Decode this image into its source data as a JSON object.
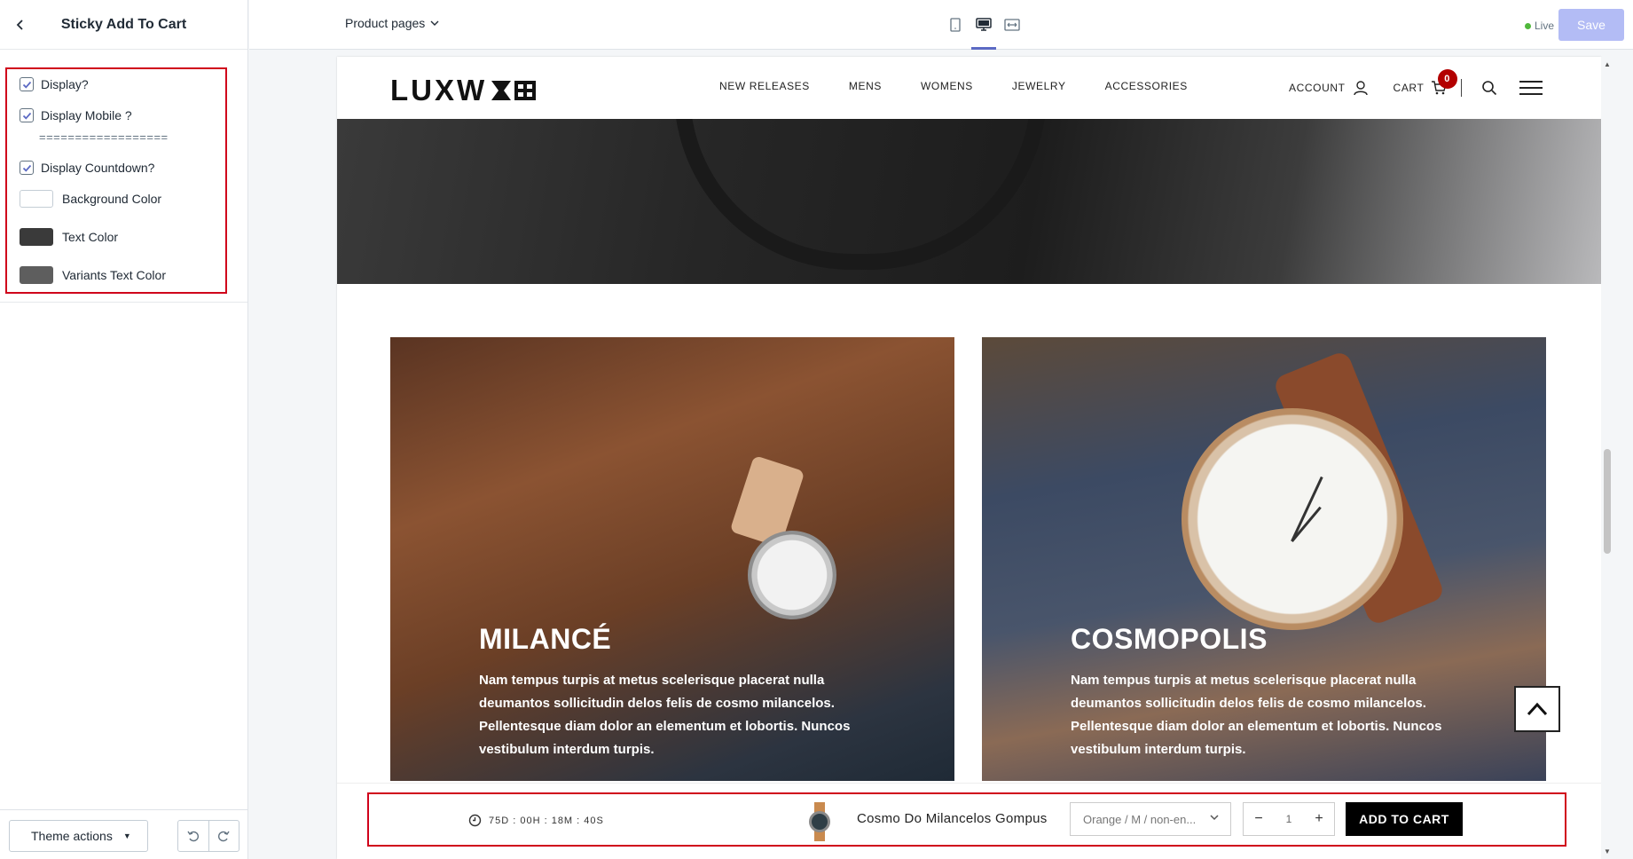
{
  "sidebar": {
    "title": "Sticky Add To Cart",
    "settings": {
      "display_label": "Display?",
      "display_mobile_label": "Display Mobile ?",
      "divider": "==================",
      "display_countdown_label": "Display Countdown?",
      "bg_color_label": "Background Color",
      "text_color_label": "Text Color",
      "variants_text_color_label": "Variants Text Color"
    },
    "colors": {
      "background": "#ffffff",
      "text": "#3a3a3a",
      "variants_text": "#5e5e5e"
    },
    "footer": {
      "theme_actions": "Theme actions"
    }
  },
  "topbar": {
    "page_selector": "Product pages",
    "live": "Live",
    "save": "Save"
  },
  "site": {
    "logo": "LUXW",
    "nav": [
      "NEW RELEASES",
      "MENS",
      "WOMENS",
      "JEWELRY",
      "ACCESSORIES"
    ],
    "account": "ACCOUNT",
    "cart": "CART",
    "cart_count": "0"
  },
  "cards": [
    {
      "title": "MILANCÉ",
      "text": "Nam tempus turpis at metus scelerisque placerat nulla deumantos sollicitudin delos felis de cosmo milancelos. Pellentesque diam dolor an elementum et lobortis. Nuncos vestibulum interdum turpis."
    },
    {
      "title": "COSMOPOLIS",
      "text": "Nam tempus turpis at metus scelerisque placerat nulla deumantos sollicitudin delos felis de cosmo milancelos. Pellentesque diam dolor an elementum et lobortis. Nuncos vestibulum interdum turpis."
    }
  ],
  "sticky_cart": {
    "countdown": "75D : 00H : 18M : 40S",
    "product_name": "Cosmo Do Milancelos Gompus",
    "variant": "Orange / M / non-en...",
    "quantity": "1",
    "add_to_cart": "ADD TO CART"
  }
}
